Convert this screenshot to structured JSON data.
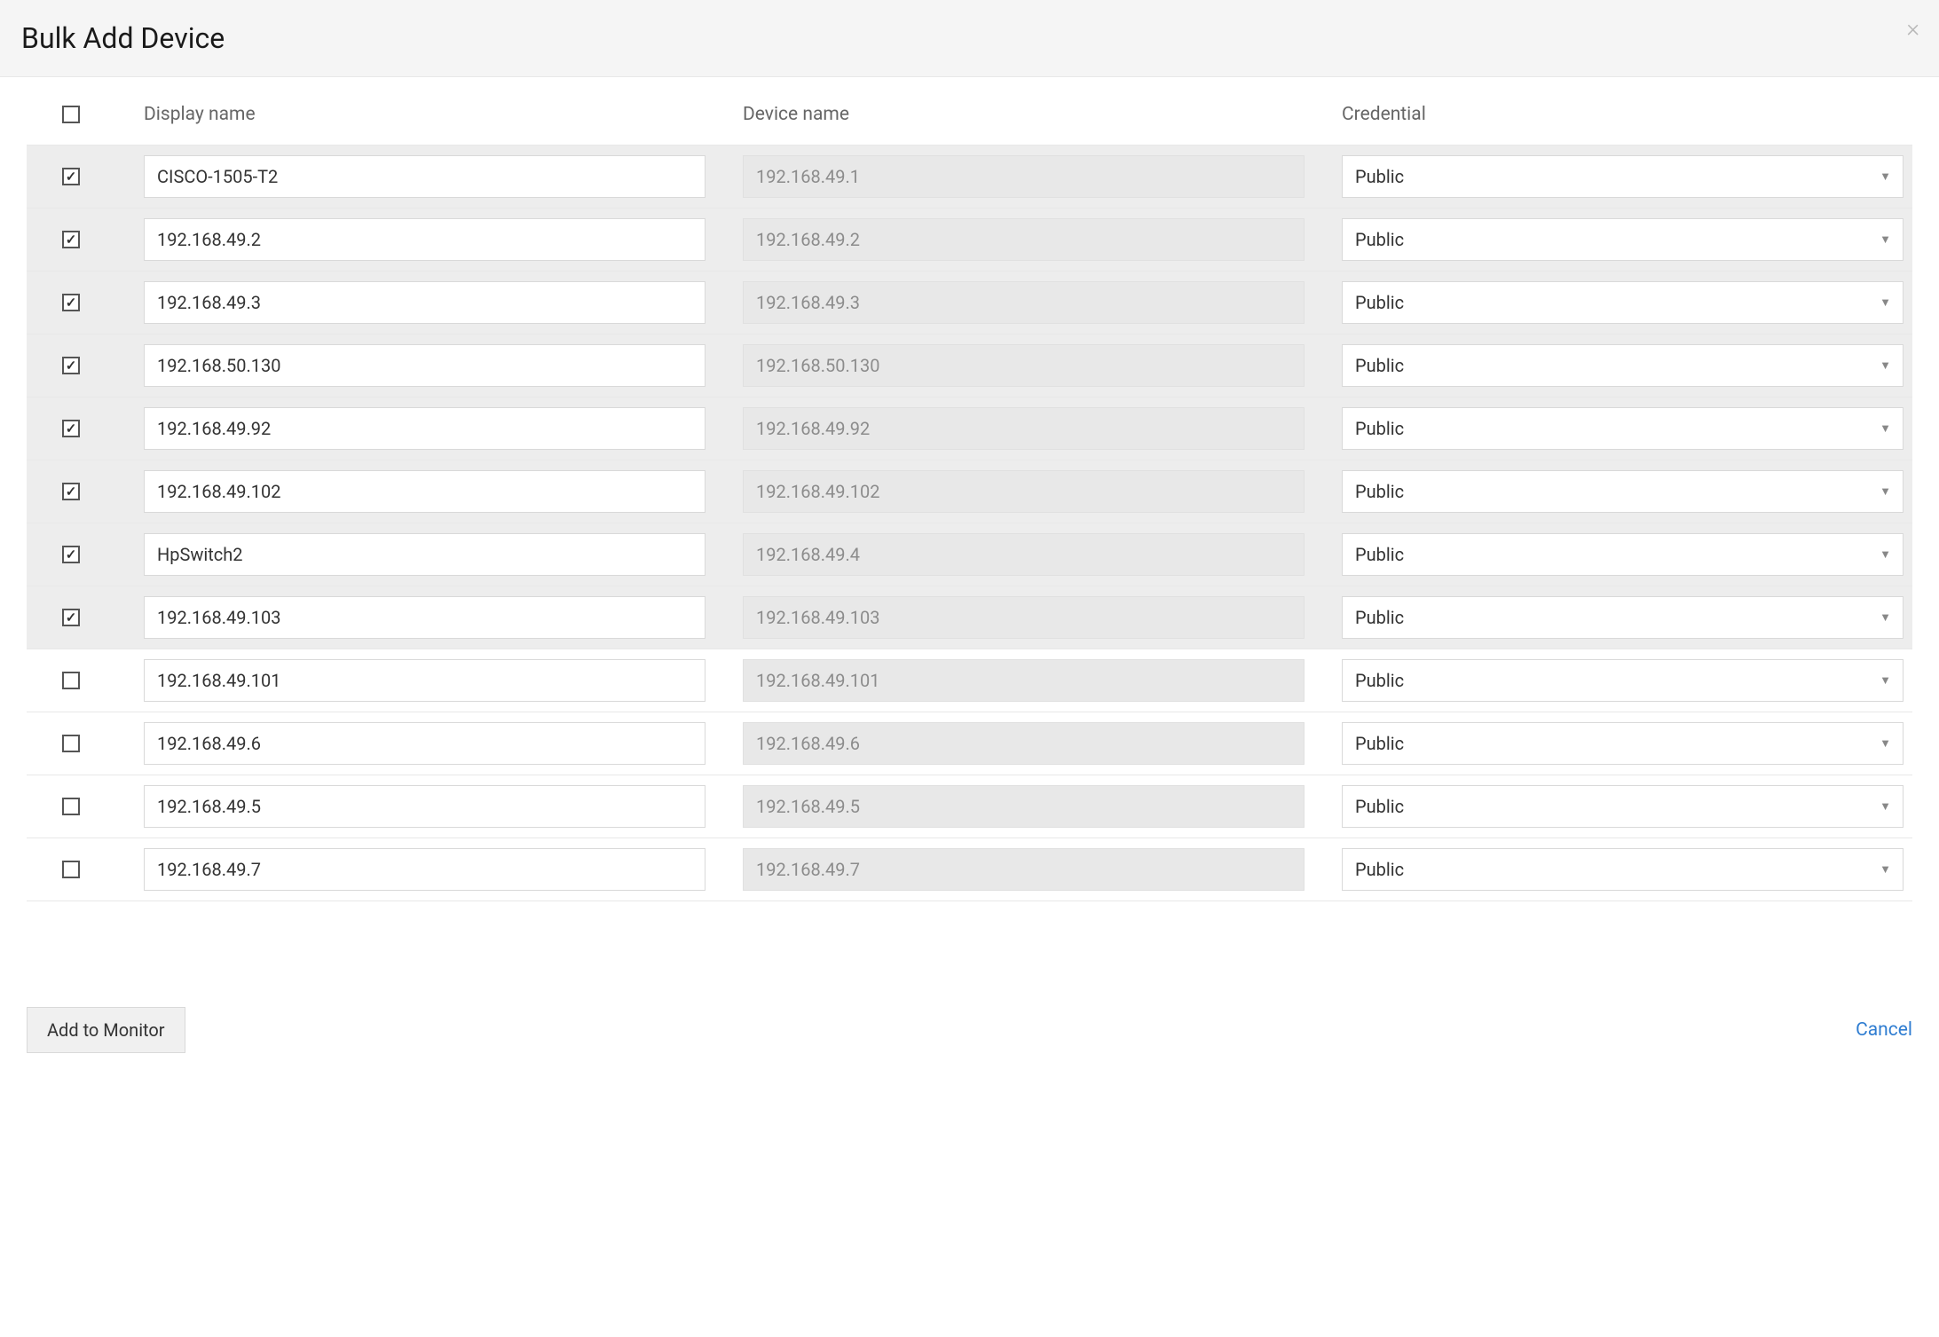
{
  "modal": {
    "title": "Bulk Add Device"
  },
  "columns": {
    "display_name": "Display name",
    "device_name": "Device name",
    "credential": "Credential"
  },
  "rows": [
    {
      "checked": true,
      "display_name": "CISCO-1505-T2",
      "device_name": "192.168.49.1",
      "credential": "Public"
    },
    {
      "checked": true,
      "display_name": "192.168.49.2",
      "device_name": "192.168.49.2",
      "credential": "Public"
    },
    {
      "checked": true,
      "display_name": "192.168.49.3",
      "device_name": "192.168.49.3",
      "credential": "Public"
    },
    {
      "checked": true,
      "display_name": "192.168.50.130",
      "device_name": "192.168.50.130",
      "credential": "Public"
    },
    {
      "checked": true,
      "display_name": "192.168.49.92",
      "device_name": "192.168.49.92",
      "credential": "Public"
    },
    {
      "checked": true,
      "display_name": "192.168.49.102",
      "device_name": "192.168.49.102",
      "credential": "Public"
    },
    {
      "checked": true,
      "display_name": "HpSwitch2",
      "device_name": "192.168.49.4",
      "credential": "Public"
    },
    {
      "checked": true,
      "display_name": "192.168.49.103",
      "device_name": "192.168.49.103",
      "credential": "Public"
    },
    {
      "checked": false,
      "display_name": "192.168.49.101",
      "device_name": "192.168.49.101",
      "credential": "Public"
    },
    {
      "checked": false,
      "display_name": "192.168.49.6",
      "device_name": "192.168.49.6",
      "credential": "Public"
    },
    {
      "checked": false,
      "display_name": "192.168.49.5",
      "device_name": "192.168.49.5",
      "credential": "Public"
    },
    {
      "checked": false,
      "display_name": "192.168.49.7",
      "device_name": "192.168.49.7",
      "credential": "Public"
    }
  ],
  "footer": {
    "add_label": "Add to Monitor",
    "cancel_label": "Cancel"
  }
}
